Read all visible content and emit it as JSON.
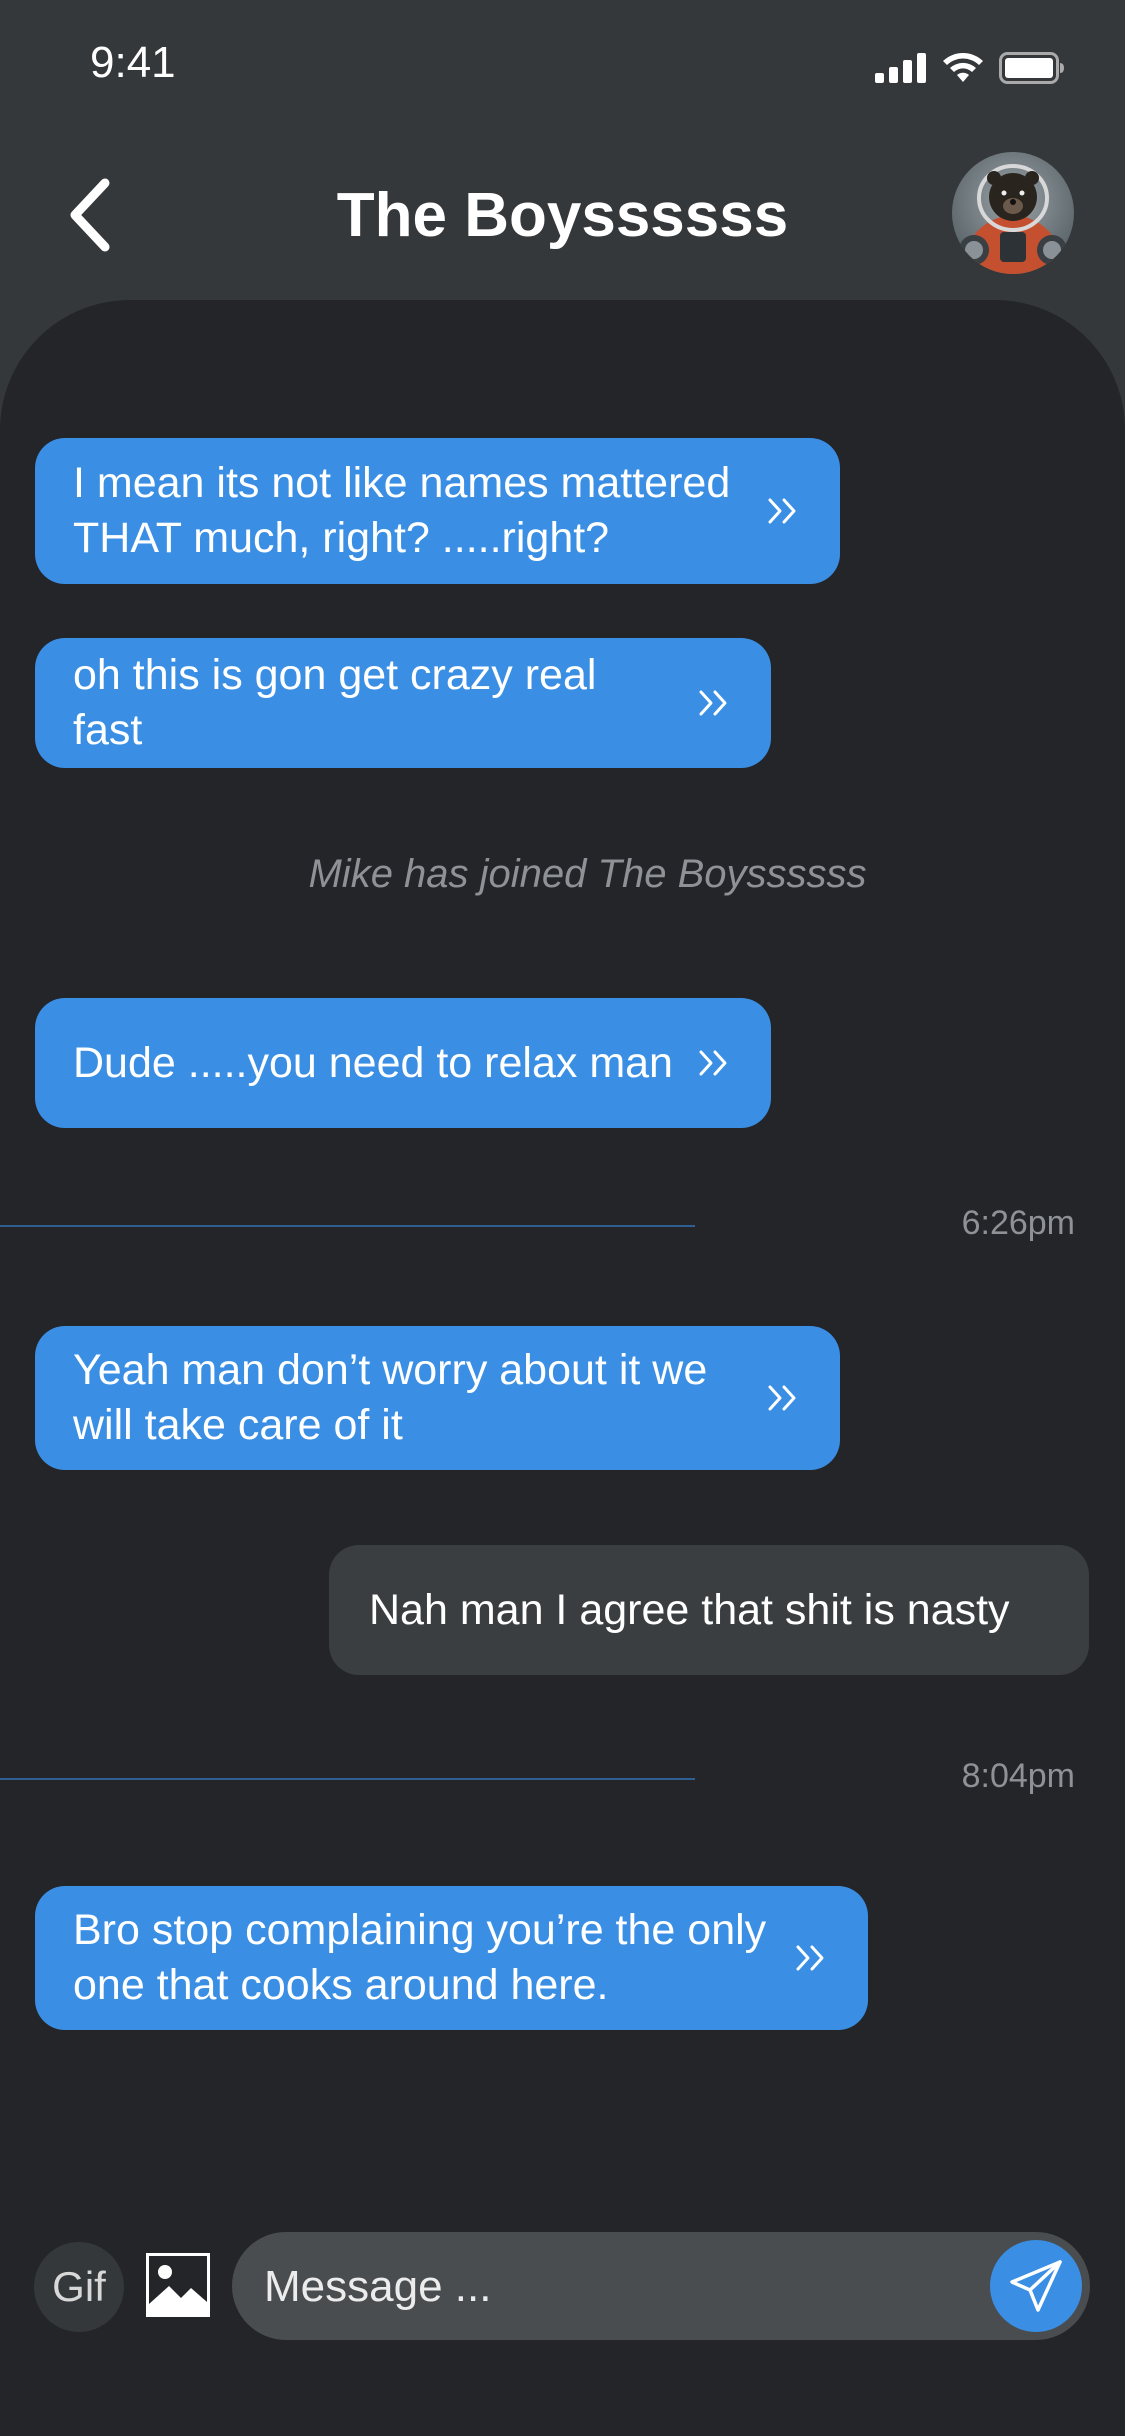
{
  "status_bar": {
    "time": "9:41",
    "icons": [
      "signal-icon",
      "wifi-icon",
      "battery-icon"
    ]
  },
  "header": {
    "title": "The Boyssssss",
    "back_icon": "chevron-left-icon",
    "avatar": "group-avatar"
  },
  "messages": [
    {
      "type": "sent",
      "text": "I mean its not like names mattered\nTHAT much, right? .....right?"
    },
    {
      "type": "sent",
      "text": "oh this is gon get crazy real fast"
    },
    {
      "type": "system",
      "text": "Mike has joined The Boyssssss"
    },
    {
      "type": "sent",
      "text": "Dude .....you need to relax man"
    },
    {
      "type": "timestamp",
      "text": "6:26pm"
    },
    {
      "type": "sent",
      "text": "Yeah man don’t worry about it we\nwill take care of it"
    },
    {
      "type": "received",
      "text": "Nah man I agree that shit is nasty"
    },
    {
      "type": "timestamp",
      "text": "8:04pm"
    },
    {
      "type": "sent",
      "text": "Bro stop complaining you’re the only\none that cooks around here."
    }
  ],
  "composer": {
    "gif_label": "Gif",
    "image_icon": "image-icon",
    "placeholder": "Message ...",
    "value": "",
    "send_icon": "send-icon"
  },
  "colors": {
    "background": "#35383b",
    "chat_background": "#232528",
    "sent_bubble": "#3a8fe4",
    "received_bubble": "#3b3e41",
    "divider": "#2f5f92"
  }
}
